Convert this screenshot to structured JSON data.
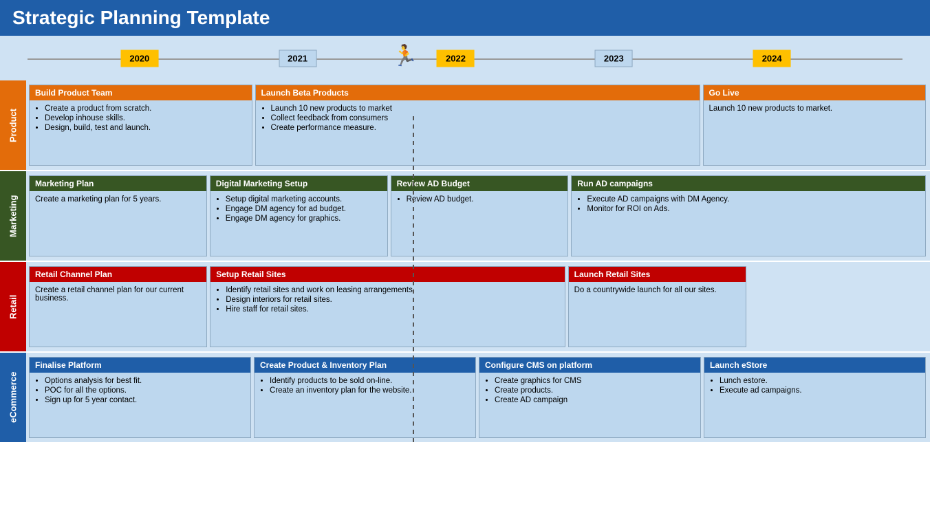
{
  "header": {
    "title": "Strategic Planning Template"
  },
  "timeline": {
    "years": [
      {
        "label": "2020",
        "type": "gold",
        "left": "15%"
      },
      {
        "label": "2021",
        "type": "blue",
        "left": "32%"
      },
      {
        "label": "2022",
        "type": "gold",
        "left": "49%"
      },
      {
        "label": "2023",
        "type": "blue",
        "left": "66%"
      },
      {
        "label": "2024",
        "type": "gold",
        "left": "83%"
      }
    ]
  },
  "rows": [
    {
      "id": "product",
      "label": "Product",
      "labelClass": "label-product",
      "cards": [
        {
          "id": "build-product-team",
          "header": "Build Product Team",
          "headerClass": "hdr-orange",
          "span": 1,
          "body": {
            "type": "list",
            "items": [
              "Create a product from scratch.",
              "Develop inhouse skills.",
              "Design, build, test and launch."
            ]
          }
        },
        {
          "id": "launch-beta-products",
          "header": "Launch Beta Products",
          "headerClass": "hdr-orange",
          "span": 2,
          "body": {
            "type": "list",
            "items": [
              "Launch 10 new products to market",
              "Collect feedback from consumers",
              "Create performance measure."
            ]
          }
        },
        {
          "id": "go-live",
          "header": "Go Live",
          "headerClass": "hdr-orange",
          "span": 1,
          "body": {
            "type": "text",
            "text": "Launch 10 new products to market."
          }
        }
      ]
    },
    {
      "id": "marketing",
      "label": "Marketing",
      "labelClass": "label-marketing",
      "cards": [
        {
          "id": "marketing-plan",
          "header": "Marketing Plan",
          "headerClass": "hdr-green",
          "span": 1,
          "body": {
            "type": "text",
            "text": "Create a marketing plan for 5 years."
          }
        },
        {
          "id": "digital-marketing-setup",
          "header": "Digital Marketing Setup",
          "headerClass": "hdr-green",
          "span": 1,
          "body": {
            "type": "list",
            "items": [
              "Setup digital marketing accounts.",
              "Engage DM agency for ad budget.",
              "Engage DM agency for graphics."
            ]
          }
        },
        {
          "id": "review-ad-budget",
          "header": "Review AD Budget",
          "headerClass": "hdr-green",
          "span": 1,
          "body": {
            "type": "list",
            "items": [
              "Review AD budget."
            ]
          }
        },
        {
          "id": "run-ad-campaigns",
          "header": "Run AD campaigns",
          "headerClass": "hdr-green",
          "span": 2,
          "body": {
            "type": "list",
            "items": [
              "Execute AD campaigns with DM Agency.",
              "Monitor for ROI on Ads."
            ]
          }
        }
      ]
    },
    {
      "id": "retail",
      "label": "Retail",
      "labelClass": "label-retail",
      "cards": [
        {
          "id": "retail-channel-plan",
          "header": "Retail Channel Plan",
          "headerClass": "hdr-red",
          "span": 1,
          "body": {
            "type": "text",
            "text": "Create a retail channel plan for our current business."
          }
        },
        {
          "id": "setup-retail-sites",
          "header": "Setup Retail Sites",
          "headerClass": "hdr-red",
          "span": 2,
          "body": {
            "type": "list",
            "items": [
              "Identify retail sites and work on leasing arrangements.",
              "Design interiors for retail sites.",
              "Hire staff for retail sites."
            ]
          }
        },
        {
          "id": "launch-retail-sites",
          "header": "Launch Retail Sites",
          "headerClass": "hdr-red",
          "span": 1,
          "body": {
            "type": "text",
            "text": "Do a countrywide launch for all our sites."
          }
        }
      ]
    },
    {
      "id": "ecommerce",
      "label": "eCommerce",
      "labelClass": "label-ecommerce",
      "cards": [
        {
          "id": "finalise-platform",
          "header": "Finalise Platform",
          "headerClass": "hdr-blue",
          "span": 1,
          "body": {
            "type": "list",
            "items": [
              "Options analysis for best fit.",
              "POC for all the options.",
              "Sign up for 5 year contact."
            ]
          }
        },
        {
          "id": "create-product-inventory-plan",
          "header": "Create Product & Inventory Plan",
          "headerClass": "hdr-blue",
          "span": 1,
          "body": {
            "type": "list",
            "items": [
              "Identify products to be sold on-line.",
              "Create an inventory plan for the website."
            ]
          }
        },
        {
          "id": "configure-cms",
          "header": "Configure CMS on platform",
          "headerClass": "hdr-blue",
          "span": 1,
          "body": {
            "type": "list",
            "items": [
              "Create graphics for CMS",
              "Create products.",
              "Create AD campaign"
            ]
          }
        },
        {
          "id": "launch-estore",
          "header": "Launch eStore",
          "headerClass": "hdr-blue",
          "span": 1,
          "body": {
            "type": "list",
            "items": [
              "Lunch estore.",
              "Execute ad campaigns."
            ]
          }
        }
      ]
    }
  ]
}
